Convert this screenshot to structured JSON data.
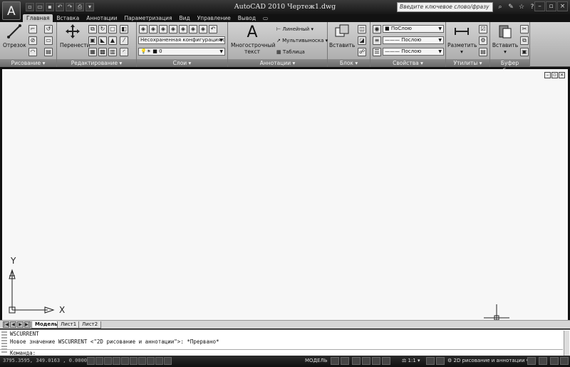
{
  "window": {
    "title": "AutoCAD 2010    Чертеж1.dwg",
    "search_placeholder": "Введите ключевое слово/фразу",
    "app_button": "A"
  },
  "ribbon_tabs": [
    "Главная",
    "Вставка",
    "Аннотации",
    "Параметризация",
    "Вид",
    "Управление",
    "Вывод"
  ],
  "panels": {
    "draw": {
      "label": "Рисование",
      "line_button": "Отрезок"
    },
    "modify": {
      "label": "Редактирование",
      "move_button": "Перенести"
    },
    "layers": {
      "label": "Слои",
      "layer_state": "Несохраненная конфигурация слоев",
      "current_layer": "0"
    },
    "annotation": {
      "label": "Аннотации",
      "mtext_line1": "Многострочный",
      "mtext_line2": "текст",
      "linear": "Линейный",
      "multileader": "Мультивыноска",
      "table": "Таблица"
    },
    "block": {
      "label": "Блок",
      "insert_button": "Вставить"
    },
    "properties": {
      "label": "Свойства",
      "color": "ПоСлою",
      "linetype": "Послою",
      "lineweight": "Послою"
    },
    "utilities": {
      "label": "Утилиты",
      "measure_button": "Разметить"
    },
    "clipboard": {
      "label": "Буфер обмена",
      "paste_button": "Вставить"
    }
  },
  "ucs": {
    "x_label": "X",
    "y_label": "Y"
  },
  "layout_tabs": [
    "Модель",
    "Лист1",
    "Лист2"
  ],
  "command": {
    "line1": "WSCURRENT",
    "line2": "Новое значение WSCURRENT <\"2D рисование и аннотации\">: *Прервано*",
    "prompt": "Команда:"
  },
  "status": {
    "coords": "3795.3595, 349.0163 , 0.0000",
    "model_label": "МОДЕЛЬ",
    "scale": "1:1",
    "workspace": "2D рисование и аннотации"
  },
  "colors": {
    "canvas": "#f7f7f7",
    "ribbon": "#c4c4c4",
    "chrome": "#161616"
  }
}
